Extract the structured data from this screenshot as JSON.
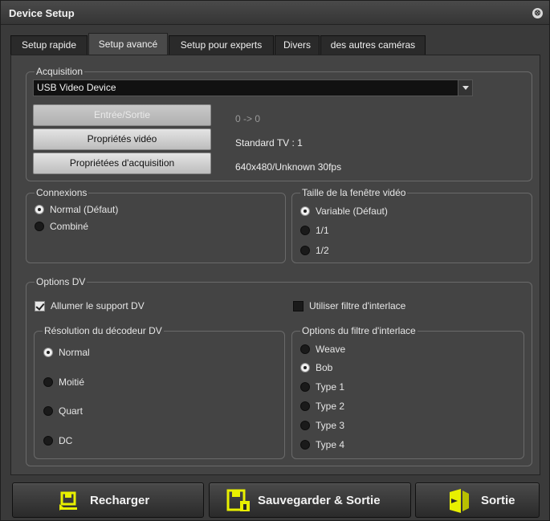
{
  "window": {
    "title": "Device Setup",
    "close_glyph": "⊗"
  },
  "tabs": [
    {
      "label": "Setup rapide",
      "active": false
    },
    {
      "label": "Setup avancé",
      "active": true
    },
    {
      "label": "Setup pour experts",
      "active": false
    },
    {
      "label": "Divers",
      "active": false
    },
    {
      "label": "des autres caméras",
      "active": false
    }
  ],
  "acquisition": {
    "label": "Acquisition",
    "device": "USB Video Device",
    "buttons": {
      "io": "Entrée/Sortie",
      "video_props": "Propriétés vidéo",
      "acq_props": "Propriétées d'acquisition"
    },
    "info": {
      "io": "0 -> 0",
      "tv_standard": "Standard TV : 1",
      "format": "640x480/Unknown 30fps"
    }
  },
  "connexions": {
    "label": "Connexions",
    "options": [
      "Normal (Défaut)",
      "Combiné"
    ],
    "selected": 0
  },
  "window_size": {
    "label": "Taille de la fenêtre vidéo",
    "options": [
      "Variable (Défaut)",
      "1/1",
      "1/2"
    ],
    "selected": 0
  },
  "dv": {
    "label": "Options DV",
    "enable_support": {
      "label": "Allumer le support DV",
      "checked": true
    },
    "interlace_filter": {
      "label": "Utiliser filtre d'interlace",
      "checked": false
    },
    "decoder": {
      "label": "Résolution du décodeur DV",
      "options": [
        "Normal",
        "Moitié",
        "Quart",
        "DC"
      ],
      "selected": 0
    },
    "filter_options": {
      "label": "Options du filtre d'interlace",
      "options": [
        "Weave",
        "Bob",
        "Type 1",
        "Type 2",
        "Type 3",
        "Type 4"
      ],
      "selected": 1
    }
  },
  "footer": {
    "reload": "Recharger",
    "save_exit": "Sauvegarder & Sortie",
    "exit": "Sortie"
  },
  "icons": {
    "reload": "reload-icon",
    "save_exit": "save-exit-icon",
    "exit": "exit-icon"
  },
  "colors": {
    "accent_icon": "#e8f000",
    "panel_bg": "#444444"
  }
}
